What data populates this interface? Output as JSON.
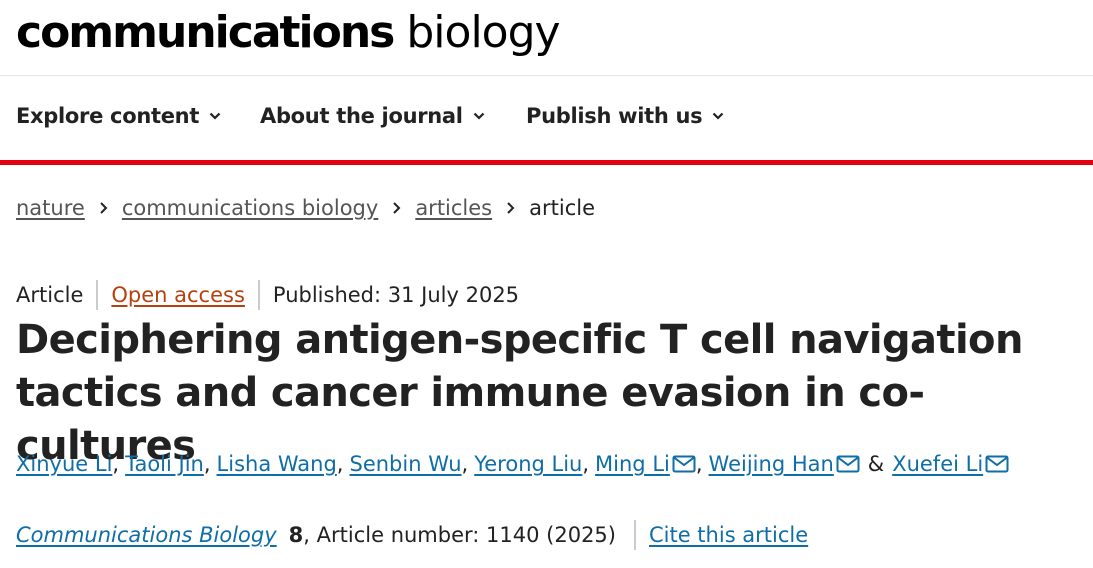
{
  "masthead": {
    "logo_bold": "communications",
    "logo_light": "biology"
  },
  "nav": {
    "items": [
      {
        "label": "Explore content",
        "icon": "chevron-down-icon"
      },
      {
        "label": "About the journal",
        "icon": "chevron-down-icon"
      },
      {
        "label": "Publish with us",
        "icon": "chevron-down-icon"
      }
    ],
    "accent_color": "#e3000f"
  },
  "breadcrumb": {
    "items": [
      "nature",
      "communications biology",
      "articles"
    ],
    "current": "article"
  },
  "article": {
    "type": "Article",
    "access": "Open access",
    "access_color": "#b7410e",
    "published": "Published: 31 July 2025",
    "title": "Deciphering antigen-specific T cell navigation tactics and cancer immune evasion in co-cultures",
    "authors": [
      {
        "name": "Xinyue Li",
        "sep": ",",
        "email": false
      },
      {
        "name": "Taoli Jin",
        "sep": ",",
        "email": false
      },
      {
        "name": "Lisha Wang",
        "sep": ",",
        "email": false
      },
      {
        "name": "Senbin Wu",
        "sep": ",",
        "email": false
      },
      {
        "name": "Yerong Liu",
        "sep": ",",
        "email": false
      },
      {
        "name": "Ming Li",
        "sep": ",",
        "email": true
      },
      {
        "name": "Weijing Han",
        "sep": "&",
        "email": true
      },
      {
        "name": "Xuefei Li",
        "sep": "",
        "email": true
      }
    ],
    "journal": "Communications Biology",
    "volume": "8",
    "article_number": ", Article number: 1140 (2025)",
    "cite_label": "Cite this article",
    "link_color": "#0f6ea8"
  }
}
